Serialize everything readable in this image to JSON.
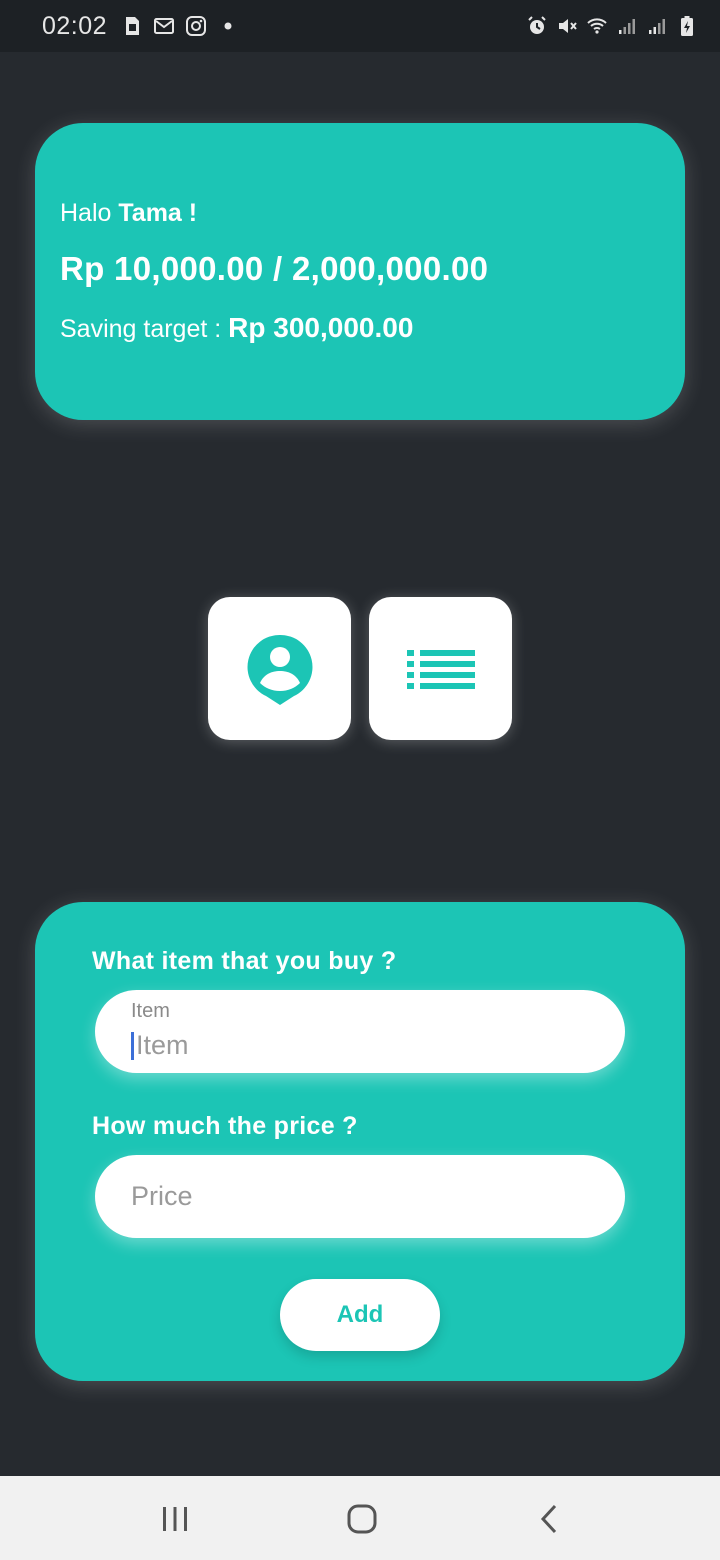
{
  "status_bar": {
    "time": "02:02",
    "left_icons": [
      "sim-card-icon",
      "gmail-icon",
      "instagram-icon",
      "dot-icon"
    ],
    "right_icons": [
      "alarm-icon",
      "mute-icon",
      "wifi-icon",
      "signal-icon",
      "signal-icon",
      "battery-charging-icon"
    ]
  },
  "summary_card": {
    "greeting_prefix": "Halo ",
    "user_name": "Tama !",
    "balance": "Rp 10,000.00 / 2,000,000.00",
    "target_label": "Saving target : ",
    "target_value": "Rp 300,000.00"
  },
  "actions": [
    {
      "icon": "profile-icon"
    },
    {
      "icon": "list-icon"
    }
  ],
  "form": {
    "item_question": "What item that you buy ?",
    "item_float_label": "Item",
    "item_hint": "Item",
    "price_question": "How much the price ?",
    "price_placeholder": "Price",
    "add_label": "Add"
  },
  "colors": {
    "accent": "#1cc5b5",
    "background": "#262a2f",
    "caret": "#3b6fd8"
  },
  "nav_bar": {
    "buttons": [
      "recents-icon",
      "home-icon",
      "back-icon"
    ]
  }
}
